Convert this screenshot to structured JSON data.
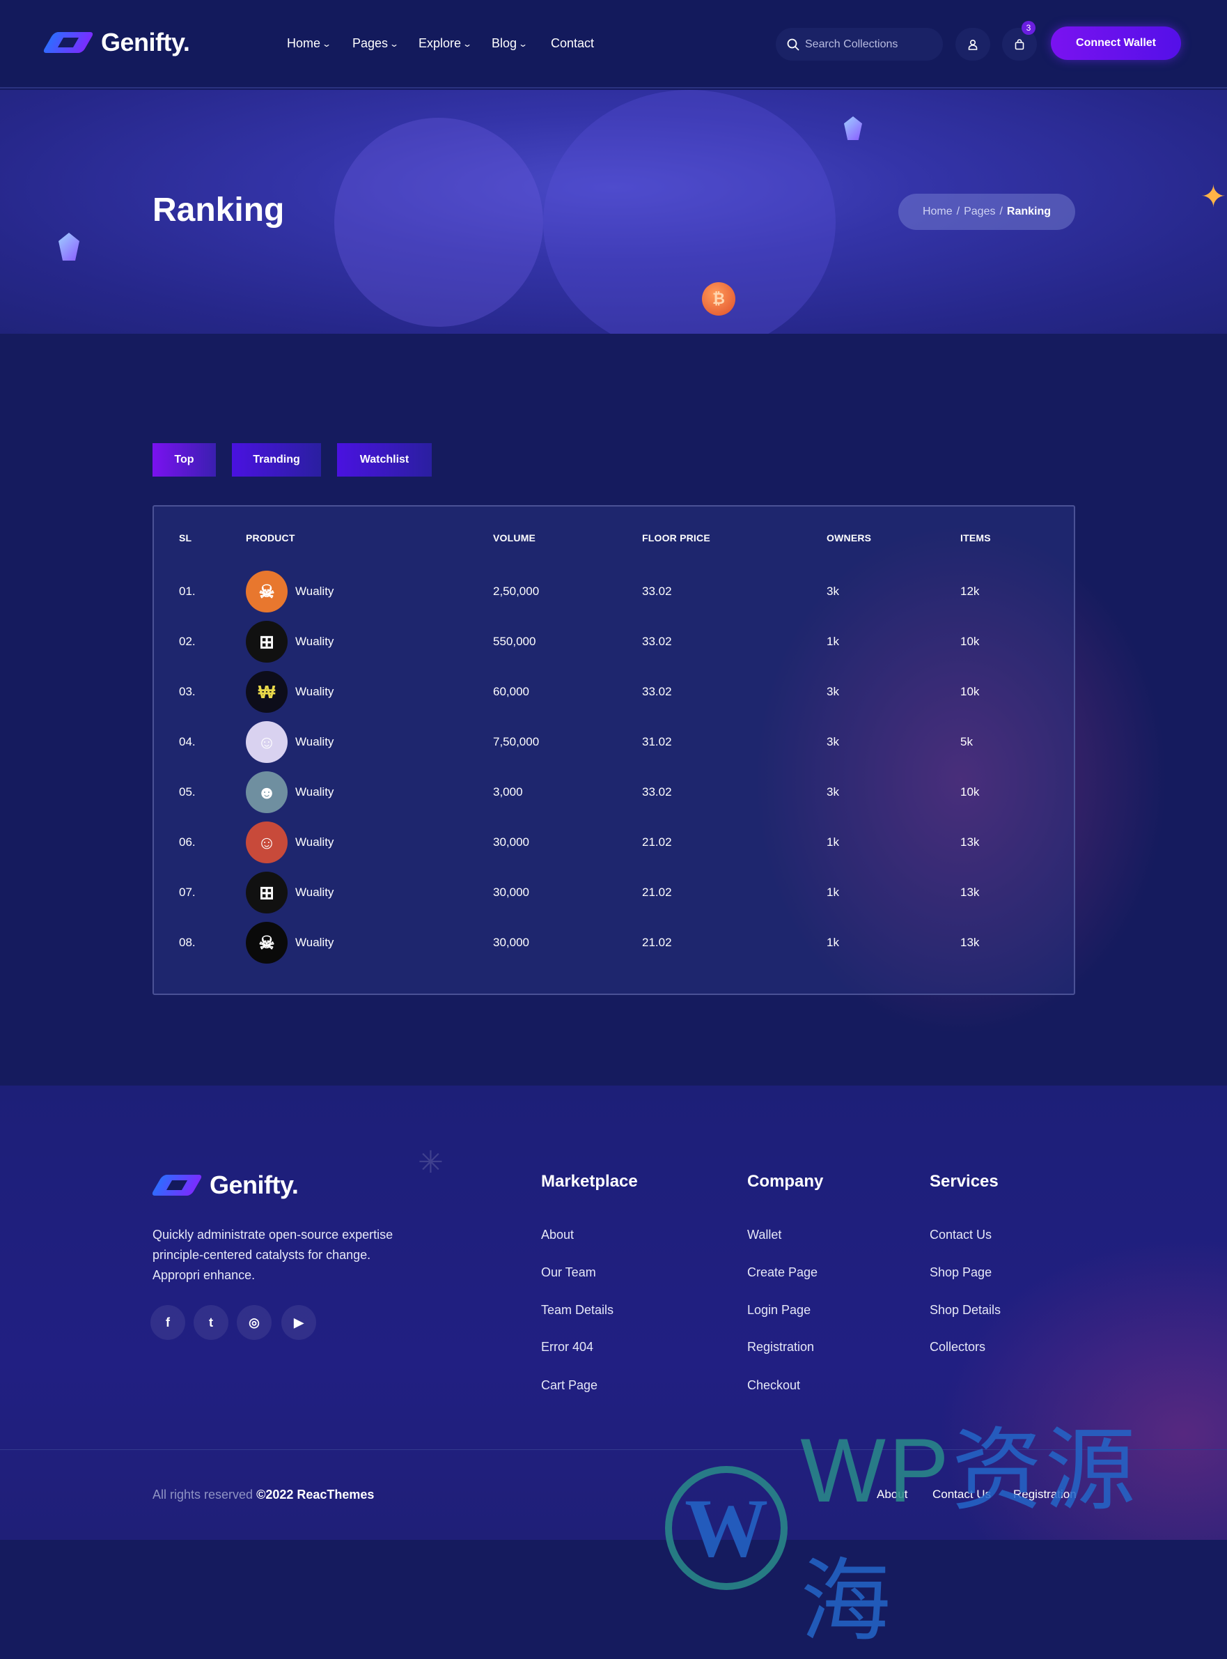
{
  "header": {
    "brand": "Genifty.",
    "nav": [
      {
        "label": "Home",
        "dropdown": true
      },
      {
        "label": "Pages",
        "dropdown": true
      },
      {
        "label": "Explore",
        "dropdown": true
      },
      {
        "label": "Blog",
        "dropdown": true
      },
      {
        "label": "Contact",
        "dropdown": false
      }
    ],
    "search_placeholder": "Search Collections",
    "cart_count": "3",
    "connect_label": "Connect Wallet"
  },
  "hero": {
    "title": "Ranking",
    "breadcrumb": [
      "Home",
      "Pages",
      "Ranking"
    ],
    "coin_symbol": "₿"
  },
  "tabs": [
    {
      "label": "Top",
      "active": true
    },
    {
      "label": "Tranding"
    },
    {
      "label": "Watchlist"
    }
  ],
  "table": {
    "headers": [
      "SL",
      "PRODUCT",
      "VOLUME",
      "FLOOR PRICE",
      "OWNERS",
      "ITEMS"
    ],
    "rows": [
      {
        "sl": "01.",
        "product": "Wuality",
        "volume": "2,50,000",
        "floor": "33.02",
        "owners": "3k",
        "items": "12k",
        "avatar_color": "#e8772e",
        "avatar_glyph": "☠"
      },
      {
        "sl": "02.",
        "product": "Wuality",
        "volume": "550,000",
        "floor": "33.02",
        "owners": "1k",
        "items": "10k",
        "avatar_color": "#111111",
        "avatar_glyph": "⊞"
      },
      {
        "sl": "03.",
        "product": "Wuality",
        "volume": "60,000",
        "floor": "33.02",
        "owners": "3k",
        "items": "10k",
        "avatar_color": "#0d0d1a",
        "avatar_glyph": "₩"
      },
      {
        "sl": "04.",
        "product": "Wuality",
        "volume": "7,50,000",
        "floor": "31.02",
        "owners": "3k",
        "items": "5k",
        "avatar_color": "#d9d2f0",
        "avatar_glyph": "☺"
      },
      {
        "sl": "05.",
        "product": "Wuality",
        "volume": "3,000",
        "floor": "33.02",
        "owners": "3k",
        "items": "10k",
        "avatar_color": "#6f8fa0",
        "avatar_glyph": "☻"
      },
      {
        "sl": "06.",
        "product": "Wuality",
        "volume": "30,000",
        "floor": "21.02",
        "owners": "1k",
        "items": "13k",
        "avatar_color": "#c84a3a",
        "avatar_glyph": "☺"
      },
      {
        "sl": "07.",
        "product": "Wuality",
        "volume": "30,000",
        "floor": "21.02",
        "owners": "1k",
        "items": "13k",
        "avatar_color": "#111111",
        "avatar_glyph": "⊞"
      },
      {
        "sl": "08.",
        "product": "Wuality",
        "volume": "30,000",
        "floor": "21.02",
        "owners": "1k",
        "items": "13k",
        "avatar_color": "#0a0a0a",
        "avatar_glyph": "☠"
      }
    ]
  },
  "footer": {
    "brand": "Genifty.",
    "description": "Quickly administrate open-source expertise principle-centered catalysts for change. Appropri enhance.",
    "social": [
      {
        "icon": "facebook-icon",
        "glyph": "f"
      },
      {
        "icon": "twitter-icon",
        "glyph": "t"
      },
      {
        "icon": "instagram-icon",
        "glyph": "◎"
      },
      {
        "icon": "youtube-icon",
        "glyph": "▶"
      }
    ],
    "columns": [
      {
        "title": "Marketplace",
        "links": [
          "About",
          "Our Team",
          "Team Details",
          "Error 404",
          "Cart Page"
        ]
      },
      {
        "title": "Company",
        "links": [
          "Wallet",
          "Create Page",
          "Login Page",
          "Registration",
          "Checkout"
        ]
      },
      {
        "title": "Services",
        "links": [
          "Contact Us",
          "Shop Page",
          "Shop Details",
          "Collectors"
        ]
      }
    ],
    "copyright_prefix": "All rights reserved",
    "copyright_bold": "©2022 ReacThemes",
    "bottom_links": [
      "About",
      "Contact Us",
      "Registration"
    ]
  },
  "watermark": {
    "glyph": "W",
    "text_latin": "WP",
    "text_cjk": "资源海"
  },
  "colors": {
    "accent": "#7a12f0",
    "background": "#151b5e",
    "header": "#131a5c"
  }
}
